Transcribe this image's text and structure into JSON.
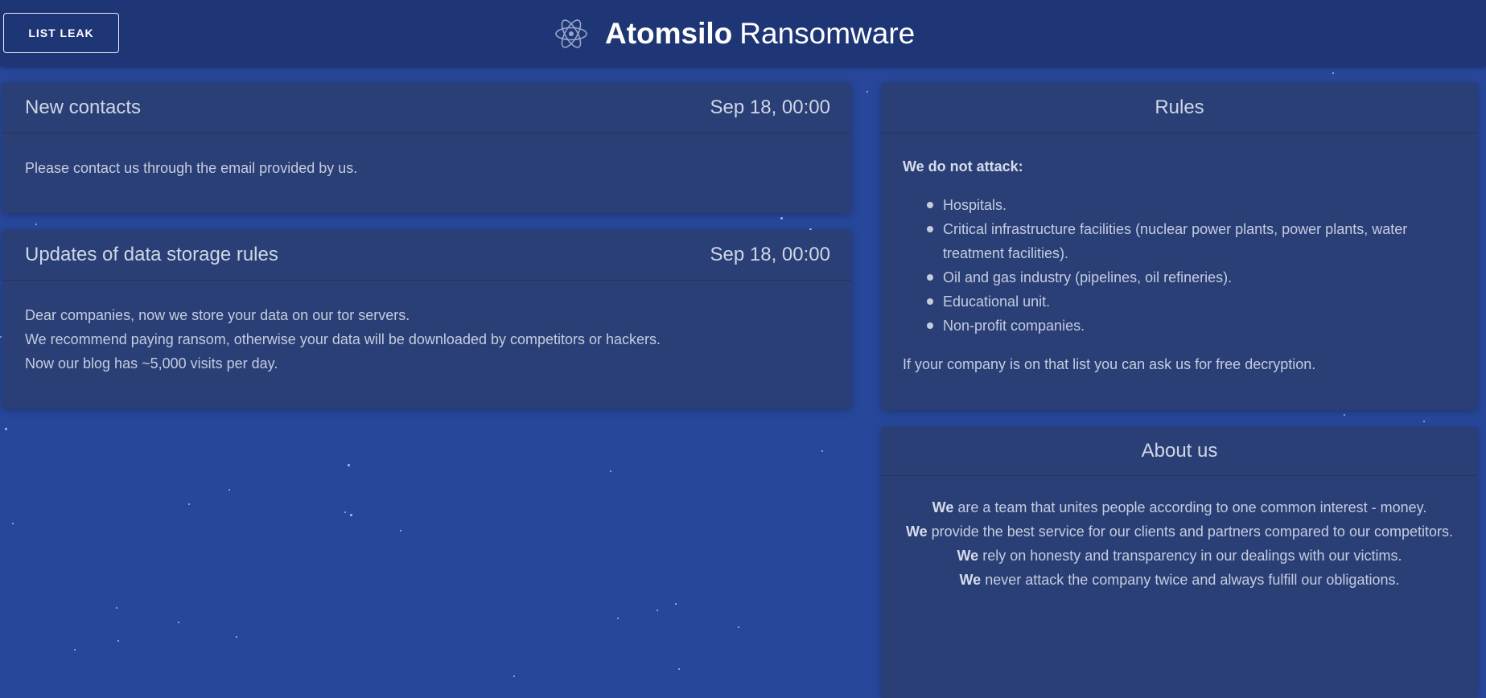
{
  "header": {
    "list_leak_label": "LIST LEAK",
    "brand_bold": "Atomsilo",
    "brand_light": "Ransomware",
    "brand_icon": "atom-icon"
  },
  "posts": [
    {
      "title": "New contacts",
      "date": "Sep 18, 00:00",
      "lines": [
        "Please contact us through the email provided by us."
      ]
    },
    {
      "title": "Updates of data storage rules",
      "date": "Sep 18, 00:00",
      "lines": [
        "Dear companies, now we store your data on our tor servers.",
        "We recommend paying ransom, otherwise your data will be downloaded by competitors or hackers.",
        "Now our blog has ~5,000 visits per day."
      ]
    }
  ],
  "rules": {
    "title": "Rules",
    "intro": "We do not attack:",
    "items": [
      "Hospitals.",
      "Critical infrastructure facilities (nuclear power plants, power plants, water treatment facilities).",
      "Oil and gas industry (pipelines, oil refineries).",
      "Educational unit.",
      "Non-profit companies."
    ],
    "footer": "If your company is on that list you can ask us for free decryption."
  },
  "about": {
    "title": "About us",
    "lines": [
      {
        "lead": "We",
        "rest": " are a team that unites people according to one common interest - money."
      },
      {
        "lead": "We",
        "rest": " provide the best service for our clients and partners compared to our competitors."
      },
      {
        "lead": "We",
        "rest": " rely on honesty and transparency in our dealings with our victims."
      },
      {
        "lead": "We",
        "rest": " never attack the company twice and always fulfill our obligations."
      }
    ]
  },
  "colors": {
    "background": "#27479a",
    "header": "#1f3676",
    "card": "#2a3f75",
    "text": "#c5cce0"
  }
}
